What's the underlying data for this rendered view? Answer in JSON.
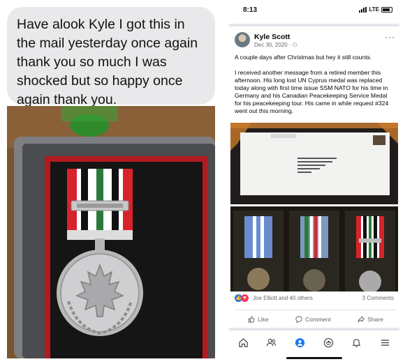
{
  "message": {
    "text": "Have  alook Kyle I got this in the mail yesterday once again thank you so much I was shocked but so happy once again thank you."
  },
  "status_bar": {
    "time": "8:13",
    "network": "LTE"
  },
  "post": {
    "author": "Kyle Scott",
    "date": "Dec 30, 2020 · ⚇",
    "more": "···",
    "paragraphs": [
      "A couple days after Christmas but hey it still counts.",
      "I received another message from a retired member this afternoon. His long lost UN Cyprus medal was replaced today along with first time issue SSM NATO for his time in Germany and his Canadian Peacekeeping Service Medal for his peacekeeping tour. His came in while request #324 went out this morning."
    ],
    "reactions_text": "Joe Elliott and 40 others",
    "comments_count": "3 Comments"
  },
  "actions": {
    "like": "Like",
    "comment": "Comment",
    "share": "Share"
  },
  "nav_icons": [
    "home-icon",
    "friends-icon",
    "profile-icon",
    "groups-icon",
    "notifications-icon",
    "menu-icon"
  ],
  "colors": {
    "bubble": "#e9e9eb",
    "fb_blue": "#1877f2",
    "love_red": "#f33e58",
    "medal_red": "#d8232a"
  }
}
